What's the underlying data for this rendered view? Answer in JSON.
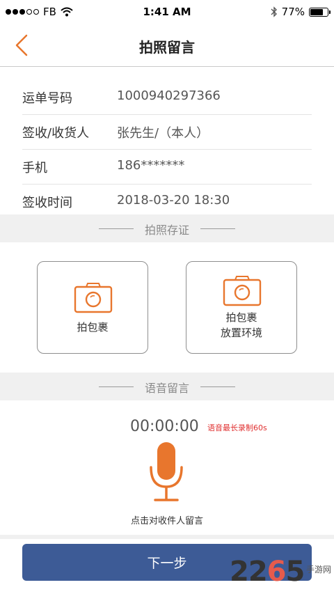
{
  "status_bar": {
    "carrier": "FB",
    "time": "1:41 AM",
    "battery": "77%",
    "battery_level": 0.77
  },
  "nav": {
    "title": "拍照留言",
    "back_icon": "chevron-left-icon"
  },
  "info": [
    {
      "label": "运单号码",
      "value": "1000940297366"
    },
    {
      "label": "签收/收货人",
      "value": "张先生/（本人）"
    },
    {
      "label": "手机",
      "value": "186*******"
    },
    {
      "label": "签收时间",
      "value": "2018-03-20   18:30"
    }
  ],
  "photo_section": {
    "title": "拍照存证",
    "cards": [
      {
        "line1": "拍包裹",
        "line2": ""
      },
      {
        "line1": "拍包裹",
        "line2": "放置环境"
      }
    ]
  },
  "voice_section": {
    "title": "语音留言",
    "timer": "00:00:00",
    "limit": "语音最长录制60s",
    "caption": "点击对收件人留言"
  },
  "next_button": "下一步",
  "watermark": {
    "main_a": "22",
    "main_b": "6",
    "main_c": "5",
    "sub": "手游网"
  },
  "colors": {
    "accent": "#e8762d",
    "button": "#3d5b96",
    "limit_text": "#e03030"
  }
}
